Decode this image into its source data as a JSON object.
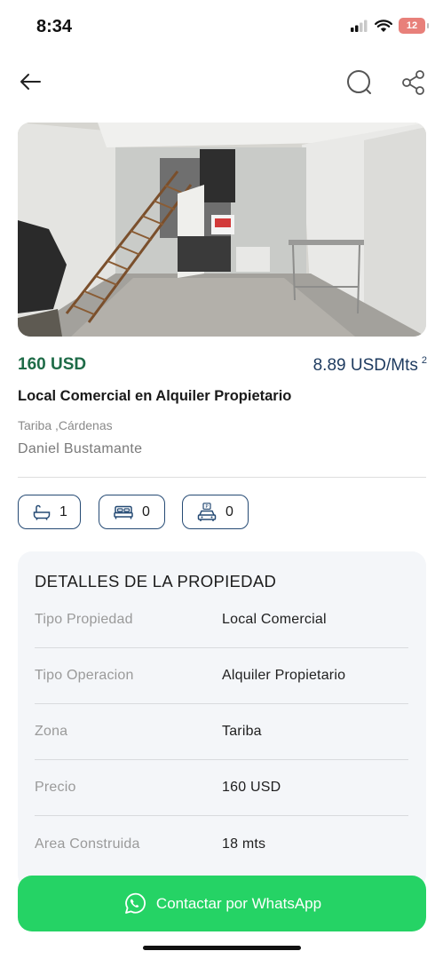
{
  "status_bar": {
    "time": "8:34",
    "battery": "12"
  },
  "listing": {
    "price": "160 USD",
    "price_per_area": "8.89 USD/Mts",
    "price_per_area_sup": "2",
    "title": "Local Comercial en Alquiler Propietario",
    "location": "Tariba ,Cárdenas",
    "agent": "Daniel Bustamante"
  },
  "features": [
    {
      "icon": "bathtub-icon",
      "value": "1"
    },
    {
      "icon": "bed-icon",
      "value": "0"
    },
    {
      "icon": "parking-car-icon",
      "value": "0"
    }
  ],
  "details": {
    "title": "DETALLES DE LA PROPIEDAD",
    "rows": [
      {
        "label": "Tipo Propiedad",
        "value": "Local Comercial"
      },
      {
        "label": "Tipo Operacion",
        "value": "Alquiler Propietario"
      },
      {
        "label": "Zona",
        "value": "Tariba"
      },
      {
        "label": "Precio",
        "value": "160 USD"
      },
      {
        "label": "Area Construida",
        "value": "18 mts"
      }
    ]
  },
  "cta": {
    "label": "Contactar por WhatsApp"
  },
  "colors": {
    "price_green": "#1e6b47",
    "navy": "#1d3a5f",
    "whatsapp": "#25d365",
    "panel_bg": "#f4f6f9"
  }
}
